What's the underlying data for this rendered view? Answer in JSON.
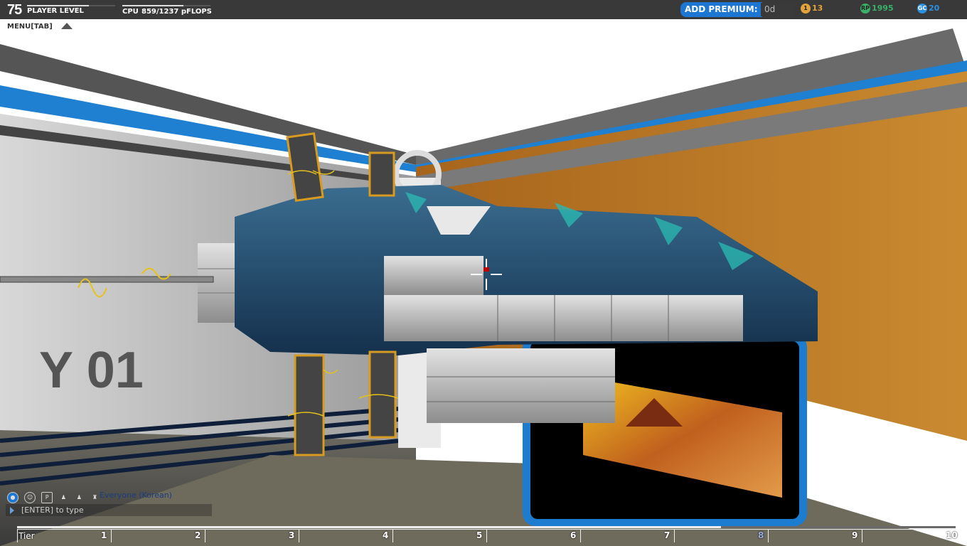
{
  "hud": {
    "player_level": "75",
    "player_level_label": "PLAYER LEVEL",
    "player_level_progress": 0.7,
    "cpu_label": "CPU",
    "cpu_value": "859/1237 pFLOPS",
    "cpu_progress": 0.69,
    "premium_label": "ADD PREMIUM:",
    "premium_value": "0d",
    "stat_tier": "13",
    "stat_rp": "1995",
    "stat_gc": "20",
    "stat_rp_icon": "RP",
    "stat_gc_icon": "GC",
    "stat_tier_icon": "1",
    "colors": {
      "accent": "#1d76d1",
      "tier_star": "#e2a33a",
      "rp": "#3ab06a",
      "gc": "#2a8fe0"
    }
  },
  "menu": {
    "label": "MENU[TAB]"
  },
  "scene": {
    "wall_text": "Y 01"
  },
  "chat": {
    "channel": "Everyone (Korean)",
    "placeholder": "[ENTER] to type",
    "icons": [
      "globe-icon",
      "person-icon",
      "party-icon",
      "friends-icon",
      "friends-2-icon",
      "clan-icon"
    ]
  },
  "tier_bar": {
    "label": "Tier",
    "tiers": [
      "1",
      "2",
      "3",
      "4",
      "5",
      "6",
      "7",
      "8",
      "9",
      "10"
    ],
    "current_tier": 8
  }
}
